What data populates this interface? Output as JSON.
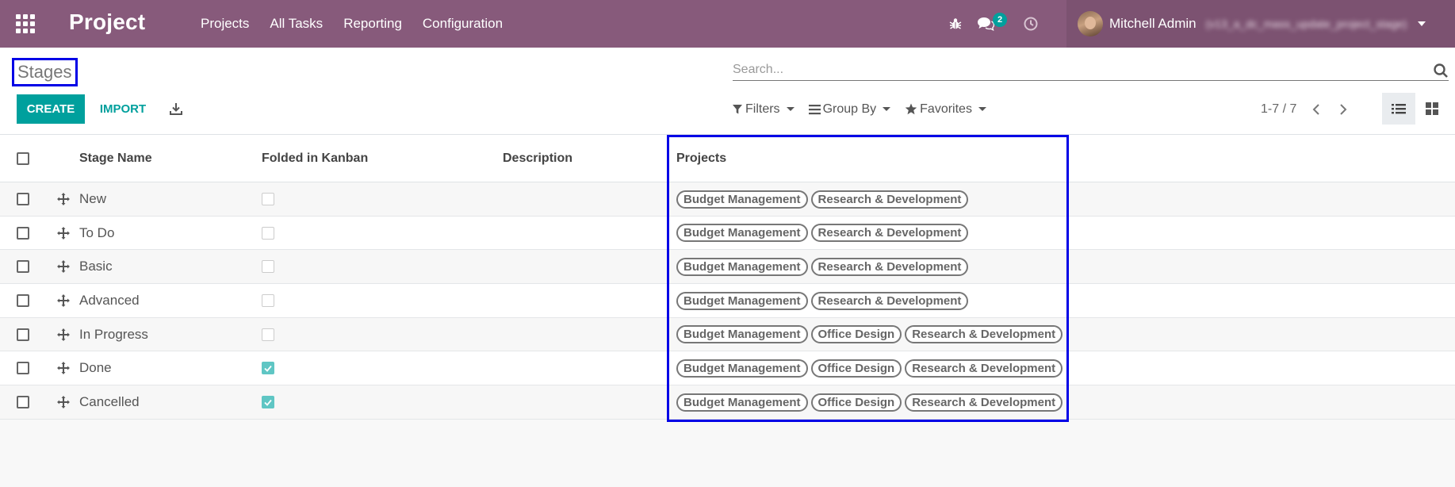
{
  "navbar": {
    "brand": "Project",
    "menu": [
      "Projects",
      "All Tasks",
      "Reporting",
      "Configuration"
    ],
    "chat_count": "2",
    "user_name": "Mitchell Admin",
    "db_name": "(v13_a_dc_mass_update_project_stage)",
    "icons": [
      "apps-icon",
      "bug-icon",
      "chat-icon",
      "clock-icon",
      "avatar"
    ]
  },
  "control_panel": {
    "title": "Stages",
    "search_placeholder": "Search...",
    "create_label": "CREATE",
    "import_label": "IMPORT",
    "filters_label": "Filters",
    "groupby_label": "Group By",
    "favorites_label": "Favorites",
    "pager": "1-7 / 7"
  },
  "columns": {
    "stage_name": "Stage Name",
    "folded": "Folded in Kanban",
    "description": "Description",
    "projects": "Projects"
  },
  "rows": [
    {
      "name": "New",
      "folded": false,
      "description": "",
      "projects": [
        "Budget Management",
        "Research & Development"
      ]
    },
    {
      "name": "To Do",
      "folded": false,
      "description": "",
      "projects": [
        "Budget Management",
        "Research & Development"
      ]
    },
    {
      "name": "Basic",
      "folded": false,
      "description": "",
      "projects": [
        "Budget Management",
        "Research & Development"
      ]
    },
    {
      "name": "Advanced",
      "folded": false,
      "description": "",
      "projects": [
        "Budget Management",
        "Research & Development"
      ]
    },
    {
      "name": "In Progress",
      "folded": false,
      "description": "",
      "projects": [
        "Budget Management",
        "Office Design",
        "Research & Development"
      ]
    },
    {
      "name": "Done",
      "folded": true,
      "description": "",
      "projects": [
        "Budget Management",
        "Office Design",
        "Research & Development"
      ]
    },
    {
      "name": "Cancelled",
      "folded": true,
      "description": "",
      "projects": [
        "Budget Management",
        "Office Design",
        "Research & Development"
      ]
    }
  ],
  "colors": {
    "navbar": "#875a7b",
    "user_menu": "#7c5271",
    "primary": "#00a09d",
    "highlight": "#0000e6",
    "checked": "#5fc6c4"
  }
}
